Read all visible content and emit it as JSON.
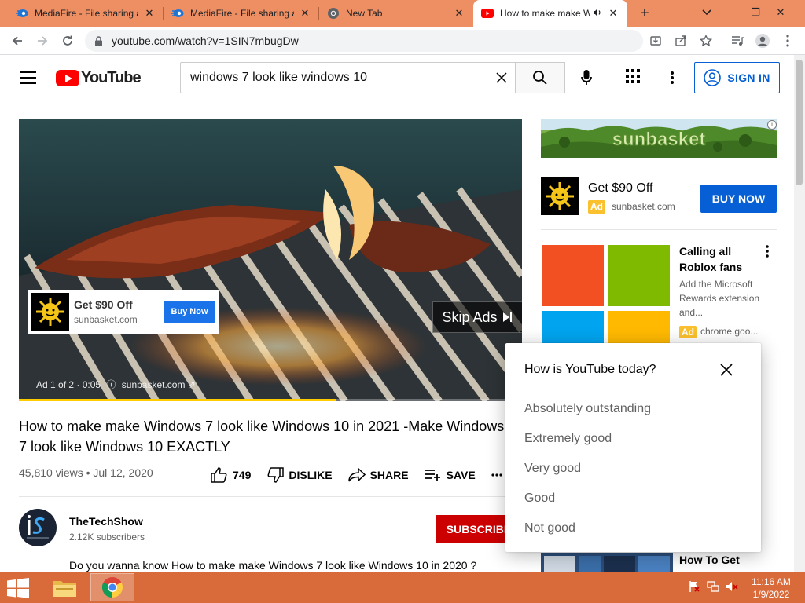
{
  "browser": {
    "tabs": [
      {
        "title": "MediaFire - File sharing a",
        "icon": "mediafire-icon"
      },
      {
        "title": "MediaFire - File sharing a",
        "icon": "mediafire-icon"
      },
      {
        "title": "New Tab",
        "icon": "chrome-icon"
      },
      {
        "title": "How to make make W",
        "icon": "youtube-icon",
        "active": true
      }
    ],
    "url": "youtube.com/watch?v=1SIN7mbugDw"
  },
  "youtube": {
    "logo_text": "YouTube",
    "search_value": "windows 7 look like windows 10",
    "sign_in_label": "SIGN IN"
  },
  "player": {
    "ad_card": {
      "headline": "Get $90 Off",
      "domain": "sunbasket.com",
      "button": "Buy Now"
    },
    "skip_label": "Skip Ads",
    "ad_info": "Ad 1 of 2 · 0:05",
    "ad_domain": "sunbasket.com",
    "ad_progress": 0.63
  },
  "video": {
    "title": "How to make make Windows 7 look like Windows 10 in 2021 -Make Windows 7 look like Windows 10 EXACTLY",
    "stats": "45,810 views • Jul 12, 2020",
    "likes": "749",
    "dislike_label": "DISLIKE",
    "share_label": "SHARE",
    "save_label": "SAVE",
    "channel": {
      "name": "TheTechShow",
      "subscribers": "2.12K subscribers",
      "subscribe_label": "SUBSCRIBE"
    },
    "description": "Do you wanna know How to make make Windows 7 look like Windows 10 in 2020 ?"
  },
  "sidebar": {
    "banner_text": "sunbasket",
    "companion_ad": {
      "headline": "Get $90 Off",
      "badge": "Ad",
      "domain": "sunbasket.com",
      "button": "BUY NOW"
    },
    "ms_ad": {
      "title": "Calling all Roblox fans",
      "description": "Add the Microsoft Rewards extension and...",
      "badge": "Ad",
      "domain": "chrome.goo..."
    },
    "next_video_title": "How To Get"
  },
  "survey": {
    "question": "How is YouTube today?",
    "options": [
      "Absolutely outstanding",
      "Extremely good",
      "Very good",
      "Good",
      "Not good"
    ]
  },
  "taskbar": {
    "time": "11:16 AM",
    "date": "1/9/2022"
  },
  "colors": {
    "tab_strip": "#ee8f63",
    "taskbar": "#d96b3b",
    "youtube_red": "#ff0000",
    "link_blue": "#065fd4",
    "ad_yellow": "#fbc02d"
  }
}
